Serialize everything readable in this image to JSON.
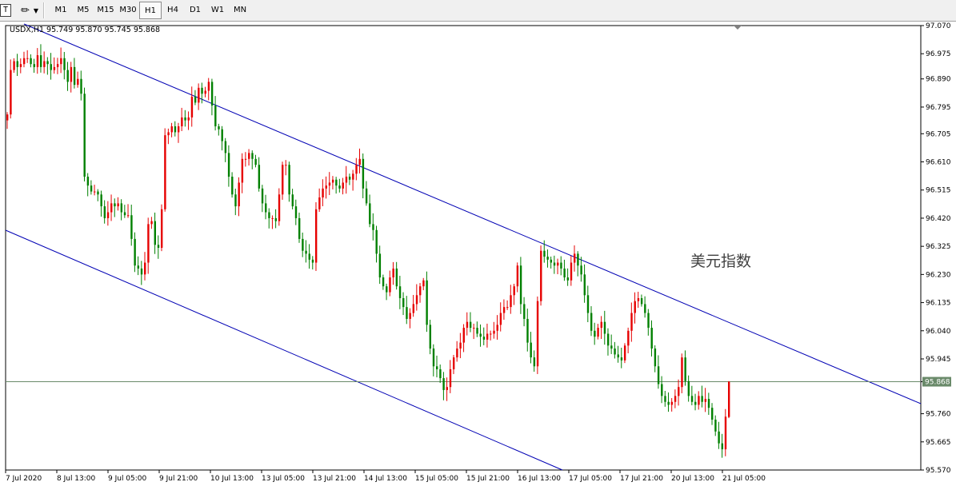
{
  "toolbar": {
    "text_tool_glyph": "T",
    "draw_tool_glyph": "✏",
    "timeframes": [
      {
        "label": "M1",
        "active": false
      },
      {
        "label": "M5",
        "active": false
      },
      {
        "label": "M15",
        "active": false
      },
      {
        "label": "M30",
        "active": false
      },
      {
        "label": "H1",
        "active": true
      },
      {
        "label": "H4",
        "active": false
      },
      {
        "label": "D1",
        "active": false
      },
      {
        "label": "W1",
        "active": false
      },
      {
        "label": "MN",
        "active": false
      }
    ]
  },
  "chart": {
    "info": "USDX,H1  95.749 95.870 95.745 95.868",
    "annotation": "美元指数",
    "current_price_label": "95.868",
    "colors": {
      "up": "#e60000",
      "down": "#008000",
      "channel": "#0000b4",
      "price_line": "#6a8a6a"
    }
  },
  "chart_data": {
    "type": "candlestick",
    "symbol": "USDX",
    "timeframe": "H1",
    "ylim": [
      95.57,
      97.07
    ],
    "y_ticks": [
      "97.070",
      "96.975",
      "96.890",
      "96.795",
      "96.705",
      "96.610",
      "96.515",
      "96.420",
      "96.325",
      "96.230",
      "96.135",
      "96.040",
      "95.945",
      "95.868",
      "95.760",
      "95.665",
      "95.570"
    ],
    "x_ticks": [
      "7 Jul 2020",
      "8 Jul 13:00",
      "9 Jul 05:00",
      "9 Jul 21:00",
      "10 Jul 13:00",
      "13 Jul 05:00",
      "13 Jul 21:00",
      "14 Jul 13:00",
      "15 Jul 05:00",
      "15 Jul 21:00",
      "16 Jul 13:00",
      "17 Jul 05:00",
      "17 Jul 21:00",
      "20 Jul 13:00",
      "21 Jul 05:00"
    ],
    "last_ohlc": {
      "open": 95.749,
      "high": 95.87,
      "low": 95.745,
      "close": 95.868
    },
    "close_path": [
      96.77,
      96.92,
      96.95,
      96.93,
      96.94,
      96.96,
      96.96,
      96.94,
      96.93,
      96.97,
      96.93,
      96.95,
      96.94,
      96.92,
      96.93,
      96.94,
      96.96,
      96.92,
      96.88,
      96.93,
      96.87,
      96.89,
      96.84,
      96.56,
      96.53,
      96.51,
      96.51,
      96.5,
      96.46,
      96.42,
      96.44,
      96.47,
      96.46,
      96.47,
      96.44,
      96.43,
      96.43,
      96.35,
      96.26,
      96.25,
      96.23,
      96.27,
      96.4,
      96.41,
      96.33,
      96.32,
      96.45,
      96.7,
      96.71,
      96.73,
      96.71,
      96.73,
      96.76,
      96.75,
      96.76,
      96.83,
      96.81,
      96.86,
      96.84,
      96.85,
      96.88,
      96.8,
      96.73,
      96.72,
      96.68,
      96.64,
      96.56,
      96.5,
      96.46,
      96.54,
      96.62,
      96.62,
      96.64,
      96.62,
      96.6,
      96.52,
      96.47,
      96.44,
      96.42,
      96.42,
      96.41,
      96.5,
      96.6,
      96.6,
      96.5,
      96.46,
      96.42,
      96.35,
      96.31,
      96.3,
      96.28,
      96.27,
      96.45,
      96.49,
      96.52,
      96.53,
      96.54,
      96.55,
      96.53,
      96.52,
      96.54,
      96.56,
      96.55,
      96.57,
      96.6,
      96.62,
      96.52,
      96.47,
      96.4,
      96.38,
      96.3,
      96.22,
      96.19,
      96.17,
      96.22,
      96.25,
      96.19,
      96.15,
      96.12,
      96.08,
      96.1,
      96.13,
      96.16,
      96.19,
      96.21,
      96.06,
      95.98,
      95.92,
      95.91,
      95.88,
      95.84,
      95.85,
      95.91,
      95.95,
      95.98,
      96.0,
      96.05,
      96.07,
      96.05,
      96.05,
      96.03,
      96.02,
      96.01,
      96.03,
      96.03,
      96.04,
      96.06,
      96.1,
      96.12,
      96.12,
      96.16,
      96.19,
      96.26,
      96.13,
      96.08,
      96.0,
      95.95,
      95.92,
      96.14,
      96.31,
      96.29,
      96.28,
      96.27,
      96.26,
      96.27,
      96.25,
      96.22,
      96.21,
      96.27,
      96.3,
      96.26,
      96.23,
      96.16,
      96.1,
      96.04,
      96.02,
      96.05,
      96.07,
      96.03,
      95.99,
      95.98,
      95.96,
      95.95,
      95.94,
      95.99,
      96.04,
      96.1,
      96.14,
      96.15,
      96.13,
      96.1,
      96.05,
      95.98,
      95.92,
      95.86,
      95.82,
      95.8,
      95.79,
      95.8,
      95.82,
      95.85,
      95.95,
      95.87,
      95.82,
      95.8,
      95.79,
      95.82,
      95.8,
      95.81,
      95.78,
      95.74,
      95.7,
      95.66,
      95.64,
      95.75,
      95.868
    ]
  }
}
